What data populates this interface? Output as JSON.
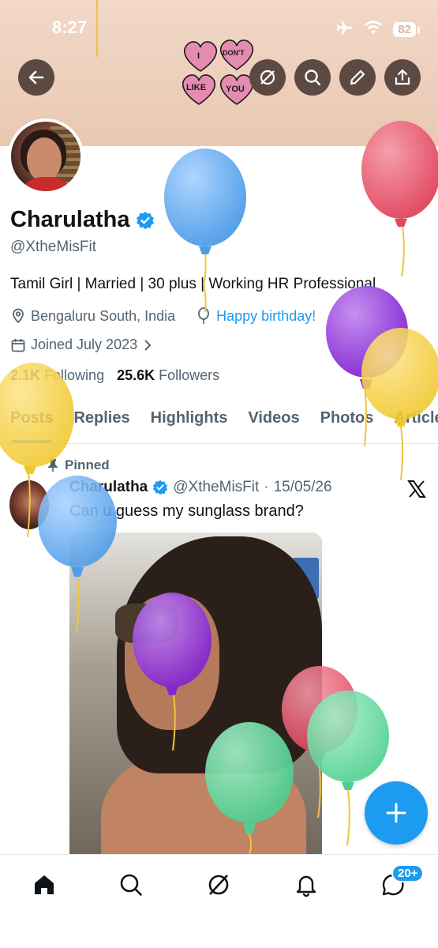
{
  "status_bar": {
    "time": "8:27",
    "battery": "82"
  },
  "banner": {
    "hearts": [
      "I",
      "DON'T",
      "LIKE",
      "YOU"
    ]
  },
  "profile": {
    "name": "Charulatha",
    "handle": "@XtheMisFit",
    "bio": "Tamil Girl | Married | 30 plus | Working HR Professional",
    "location": "Bengaluru South, India",
    "birthday": "Happy birthday!",
    "joined": "Joined July 2023",
    "following_count": "2.1K",
    "following_label": "Following",
    "followers_count": "25.6K",
    "followers_label": "Followers"
  },
  "tabs": [
    {
      "label": "Posts",
      "active": true
    },
    {
      "label": "Replies"
    },
    {
      "label": "Highlights"
    },
    {
      "label": "Videos"
    },
    {
      "label": "Photos"
    },
    {
      "label": "Articles"
    }
  ],
  "post": {
    "pinned_label": "Pinned",
    "author": "Charulatha",
    "handle": "@XtheMisFit",
    "separator": "·",
    "date": "15/05/26",
    "text": "Can u guess my sunglass brand?"
  },
  "nav": {
    "messages_badge": "20+",
    "icons": [
      "home-icon",
      "search-icon",
      "grok-icon",
      "notifications-icon",
      "messages-icon"
    ]
  },
  "colors": {
    "accent": "#1d9bf0",
    "balloon_blue": "#5aa7ef",
    "balloon_pink": "#e4506a",
    "balloon_purple": "#8b2fd6",
    "balloon_yellow": "#f4cf3c",
    "balloon_green": "#5cd79a"
  }
}
